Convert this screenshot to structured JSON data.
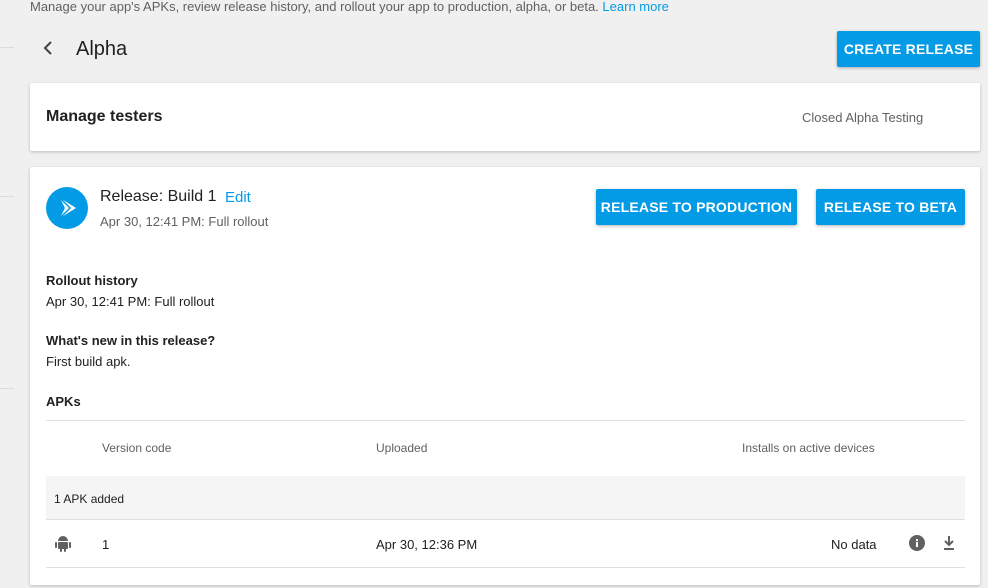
{
  "page": {
    "description": "Manage your app's APKs, review release history, and rollout your app to production, alpha, or beta.",
    "learn_more": "Learn more"
  },
  "header": {
    "title": "Alpha",
    "create_label": "CREATE RELEASE"
  },
  "testers": {
    "title": "Manage testers",
    "status": "Closed Alpha Testing"
  },
  "release": {
    "name": "Release: Build 1",
    "edit_label": "Edit",
    "subtitle": "Apr 30, 12:41 PM: Full rollout",
    "production_label": "RELEASE TO PRODUCTION",
    "beta_label": "RELEASE TO BETA",
    "rollout_heading": "Rollout history",
    "rollout_text": "Apr 30, 12:41 PM: Full rollout",
    "whats_new_heading": "What's new in this release?",
    "whats_new_text": "First build apk.",
    "apks_heading": "APKs"
  },
  "apk_table": {
    "columns": [
      "Version code",
      "Uploaded",
      "Installs on active devices"
    ],
    "group_label": "1 APK added",
    "rows": [
      {
        "version": "1",
        "uploaded": "Apr 30, 12:36 PM",
        "installs": "No data"
      }
    ]
  },
  "colors": {
    "accent": "#039be5",
    "background": "#f0f0f0"
  },
  "icons": [
    "chevron-left-icon",
    "play-arrow-icon",
    "android-icon",
    "info-icon",
    "download-icon"
  ]
}
